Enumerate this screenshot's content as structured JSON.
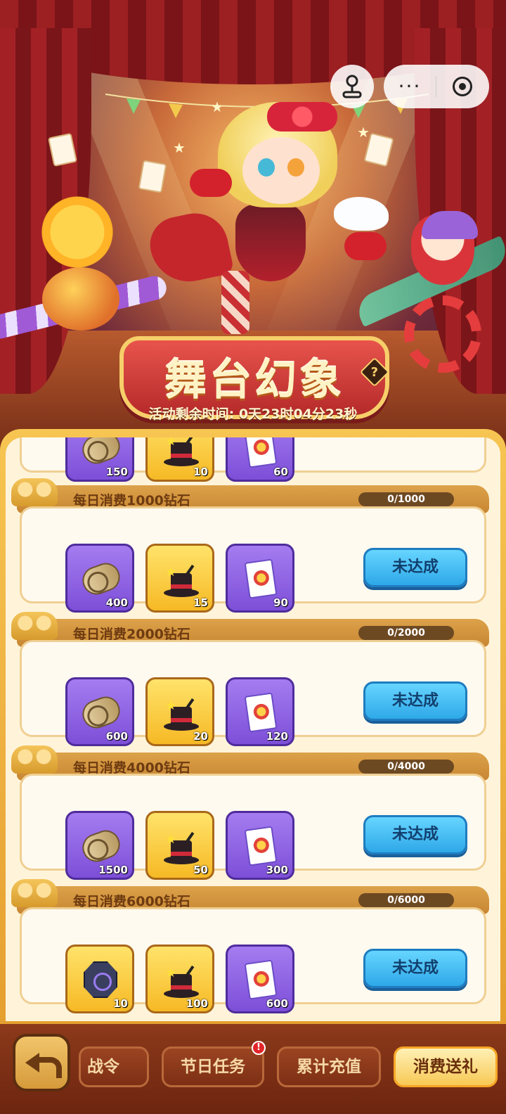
{
  "header": {
    "title": "舞台幻象",
    "timer_label": "活动剩余时间: 0天23时04分23秒",
    "capsule_more": "···",
    "icons": [
      "joystick-icon",
      "more-icon",
      "target-icon",
      "help-icon"
    ]
  },
  "partial_task": {
    "rewards": [
      {
        "icon": "scroll-icon",
        "qty": "150",
        "style": "purple"
      },
      {
        "icon": "magic-hat-icon",
        "qty": "10",
        "style": "gold"
      },
      {
        "icon": "joker-card-icon",
        "qty": "60",
        "style": "purple"
      }
    ]
  },
  "tasks": [
    {
      "title": "每日消费1000钻石",
      "progress": "0/1000",
      "status": "未达成",
      "rewards": [
        {
          "icon": "scroll-icon",
          "qty": "400",
          "style": "purple"
        },
        {
          "icon": "magic-hat-icon",
          "qty": "15",
          "style": "gold"
        },
        {
          "icon": "joker-card-icon",
          "qty": "90",
          "style": "purple"
        }
      ]
    },
    {
      "title": "每日消费2000钻石",
      "progress": "0/2000",
      "status": "未达成",
      "rewards": [
        {
          "icon": "scroll-icon",
          "qty": "600",
          "style": "purple"
        },
        {
          "icon": "magic-hat-icon",
          "qty": "20",
          "style": "gold"
        },
        {
          "icon": "joker-card-icon",
          "qty": "120",
          "style": "purple"
        }
      ]
    },
    {
      "title": "每日消费4000钻石",
      "progress": "0/4000",
      "status": "未达成",
      "rewards": [
        {
          "icon": "scroll-icon",
          "qty": "1500",
          "style": "purple"
        },
        {
          "icon": "magic-hat-icon",
          "qty": "50",
          "style": "gold"
        },
        {
          "icon": "joker-card-icon",
          "qty": "300",
          "style": "purple"
        }
      ]
    },
    {
      "title": "每日消费6000钻石",
      "progress": "0/6000",
      "status": "未达成",
      "rewards": [
        {
          "icon": "rune-coin-icon",
          "qty": "10",
          "style": "gold"
        },
        {
          "icon": "magic-hat-icon",
          "qty": "100",
          "style": "gold"
        },
        {
          "icon": "joker-card-icon",
          "qty": "600",
          "style": "purple"
        }
      ]
    }
  ],
  "bottom_nav": {
    "tabs": [
      {
        "label": "战令",
        "active": false
      },
      {
        "label": "节日任务",
        "active": false,
        "badge": "!"
      },
      {
        "label": "累计充值",
        "active": false
      },
      {
        "label": "消费送礼",
        "active": true
      }
    ]
  },
  "colors": {
    "panel_bg": "#fff4da",
    "button_blue": "#2ea8e8",
    "title_red": "#b52a2a",
    "gold": "#f7c552"
  }
}
